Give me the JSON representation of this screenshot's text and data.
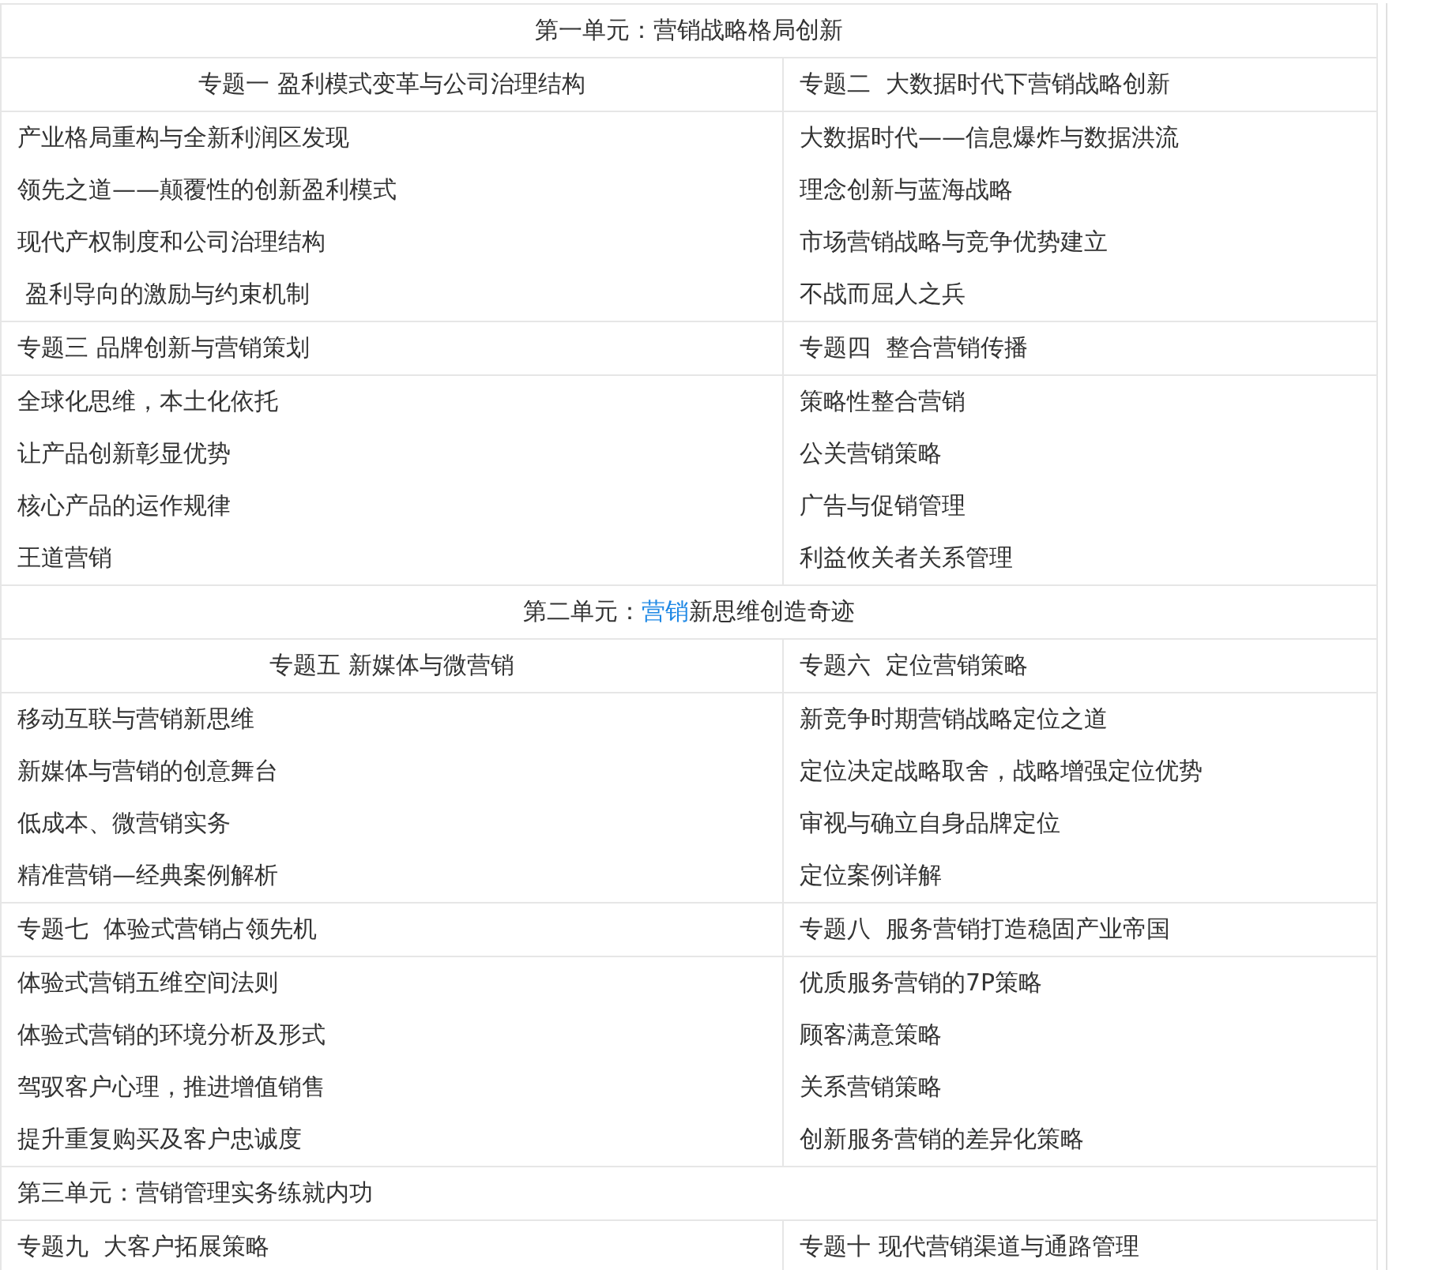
{
  "rows": [
    {
      "kind": "unit",
      "centered": true,
      "parts": [
        {
          "text": "第一单元：营销战略格局创新",
          "link": false
        }
      ]
    },
    {
      "kind": "topic",
      "cells": [
        {
          "text": "专题一 盈利模式变革与公司治理结构",
          "centered": true
        },
        {
          "text": "专题二  大数据时代下营销战略创新",
          "centered": false
        }
      ]
    },
    {
      "kind": "items",
      "left": [
        "产业格局重构与全新利润区发现",
        "领先之道——颠覆性的创新盈利模式",
        "现代产权制度和公司治理结构",
        " 盈利导向的激励与约束机制"
      ],
      "right": [
        "大数据时代——信息爆炸与数据洪流",
        "理念创新与蓝海战略",
        "市场营销战略与竞争优势建立",
        "不战而屈人之兵"
      ]
    },
    {
      "kind": "topic",
      "cells": [
        {
          "text": "专题三 品牌创新与营销策划",
          "centered": false
        },
        {
          "text": "专题四  整合营销传播",
          "centered": false
        }
      ]
    },
    {
      "kind": "items",
      "left": [
        "全球化思维，本土化依托",
        "让产品创新彰显优势",
        "核心产品的运作规律",
        "王道营销"
      ],
      "right": [
        "策略性整合营销",
        "公关营销策略",
        "广告与促销管理",
        "利益攸关者关系管理"
      ]
    },
    {
      "kind": "unit",
      "centered": true,
      "parts": [
        {
          "text": "第二单元：",
          "link": false
        },
        {
          "text": "营销",
          "link": true
        },
        {
          "text": "新思维创造奇迹",
          "link": false
        }
      ]
    },
    {
      "kind": "topic",
      "cells": [
        {
          "text": "专题五 新媒体与微营销",
          "centered": true
        },
        {
          "text": "专题六  定位营销策略",
          "centered": false
        }
      ]
    },
    {
      "kind": "items",
      "left": [
        "移动互联与营销新思维",
        "新媒体与营销的创意舞台",
        "低成本、微营销实务",
        "精准营销—经典案例解析"
      ],
      "right": [
        "新竞争时期营销战略定位之道",
        "定位决定战略取舍，战略增强定位优势",
        "审视与确立自身品牌定位",
        "定位案例详解"
      ]
    },
    {
      "kind": "topic",
      "cells": [
        {
          "text": "专题七  体验式营销占领先机",
          "centered": false
        },
        {
          "text": "专题八  服务营销打造稳固产业帝国",
          "centered": false
        }
      ]
    },
    {
      "kind": "items",
      "left": [
        "体验式营销五维空间法则",
        "体验式营销的环境分析及形式",
        "驾驭客户心理，推进增值销售",
        "提升重复购买及客户忠诚度"
      ],
      "right": [
        "优质服务营销的7P策略",
        "顾客满意策略",
        "关系营销策略",
        "创新服务营销的差异化策略"
      ]
    },
    {
      "kind": "unit",
      "centered": false,
      "parts": [
        {
          "text": "第三单元：营销管理实务练就内功",
          "link": false
        }
      ]
    },
    {
      "kind": "topic",
      "cells": [
        {
          "text": "专题九  大客户拓展策略",
          "centered": false
        },
        {
          "text": "专题十 现代营销渠道与通路管理",
          "centered": false
        }
      ]
    }
  ]
}
